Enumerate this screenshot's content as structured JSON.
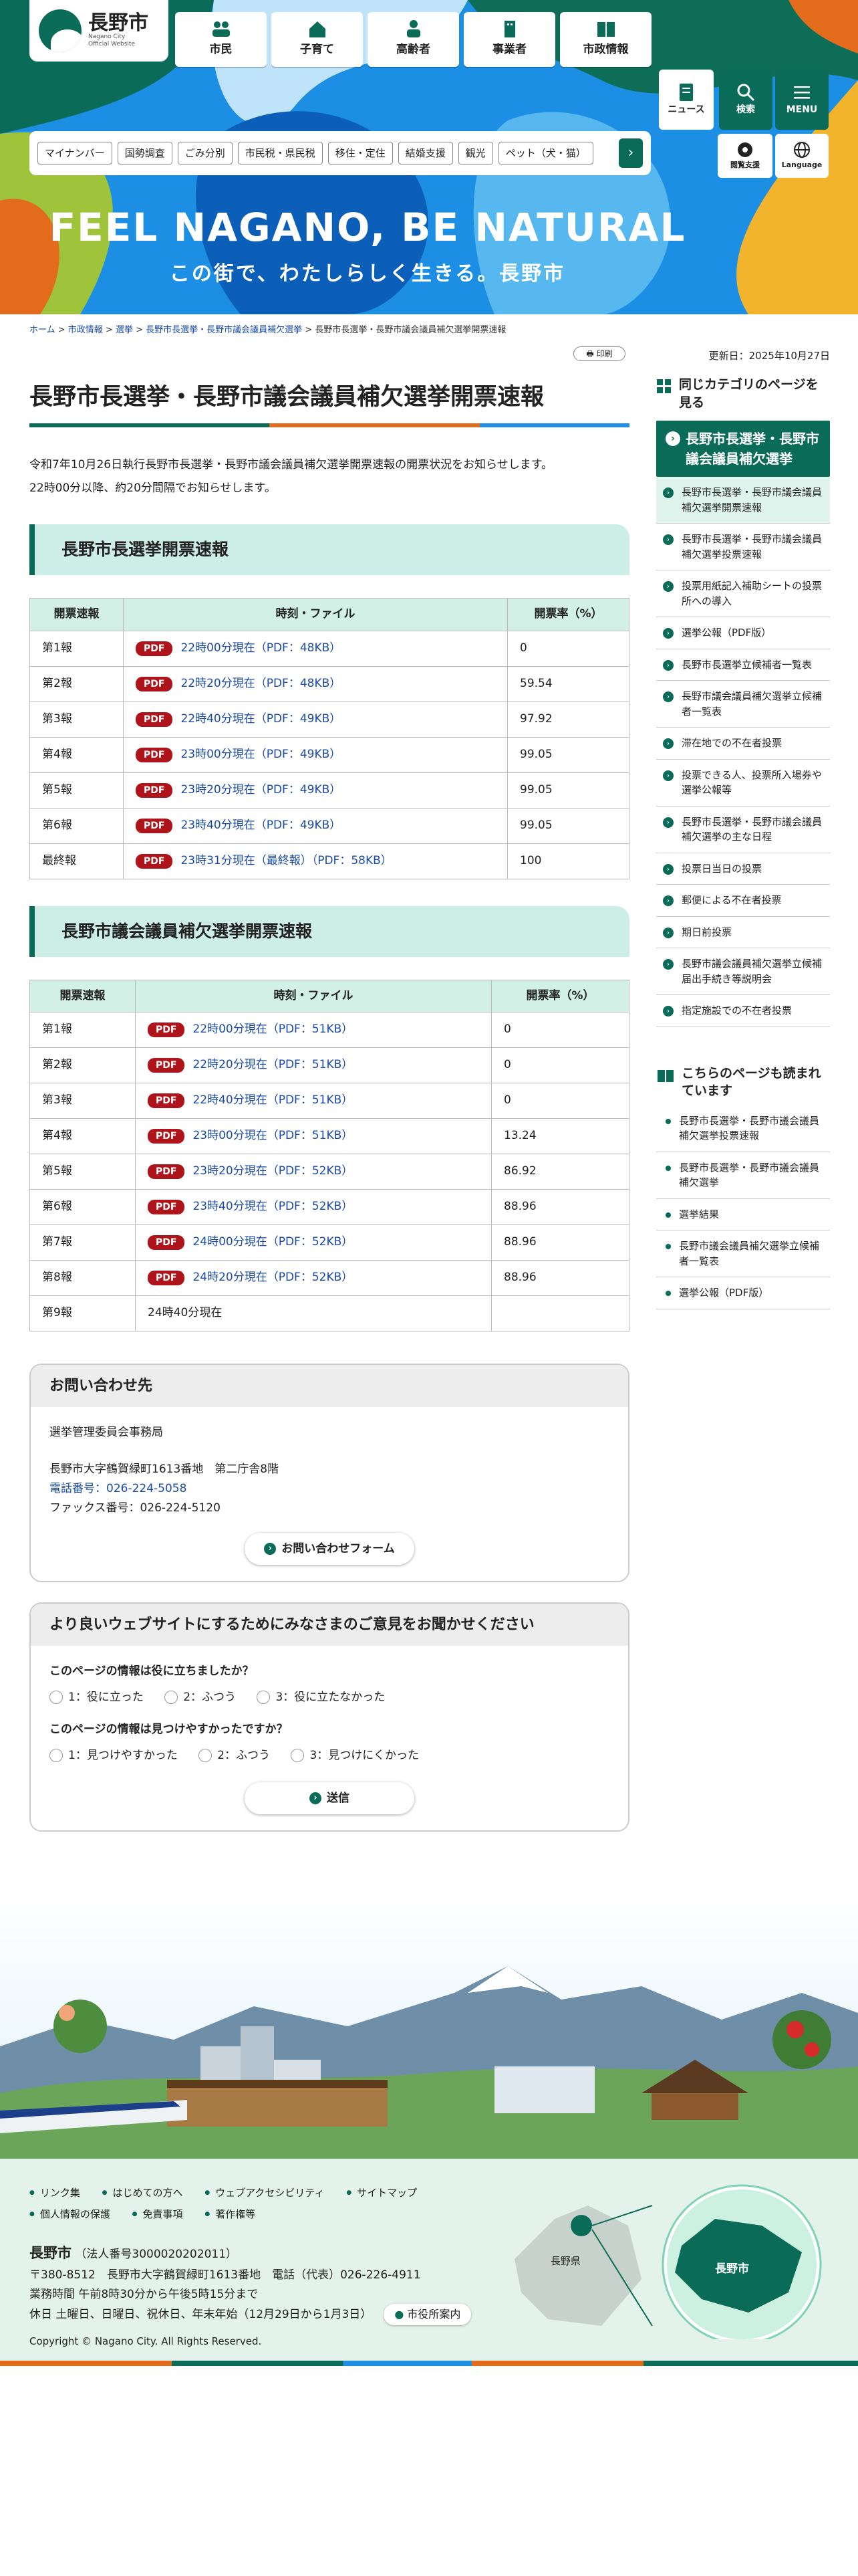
{
  "header": {
    "logo_name": "長野市",
    "logo_sub1": "Nagano City",
    "logo_sub2": "Official Website",
    "nav": [
      "市民",
      "子育て",
      "高齢者",
      "事業者",
      "市政情報"
    ],
    "news": "ニュース",
    "search": "検索",
    "menu": "MENU",
    "reader": "閲覧支援",
    "language": "Language",
    "categories": [
      "マイナンバー",
      "国勢調査",
      "ごみ分別",
      "市民税・県民税",
      "移住・定住",
      "結婚支援",
      "観光",
      "ペット（犬・猫）"
    ],
    "slogan_en": "FEEL NAGANO, BE NATURAL",
    "slogan_jp": "この街で、わたしらしく生きる。長野市"
  },
  "breadcrumb": {
    "home": "ホーム",
    "b1": "市政情報",
    "b2": "選挙",
    "b3": "長野市長選挙・長野市議会議員補欠選挙",
    "current": "長野市長選挙・長野市議会議員補欠選挙開票速報"
  },
  "print": "印刷",
  "updated": "更新日：2025年10月27日",
  "page": {
    "title": "長野市長選挙・長野市議会議員補欠選挙開票速報",
    "lead1": "令和7年10月26日執行長野市長選挙・長野市議会議員補欠選挙開票速報の開票状況をお知らせします。",
    "lead2": "22時00分以降、約20分間隔でお知らせします。",
    "pdf_badge": "PDF",
    "section1": "長野市長選挙開票速報",
    "section2": "長野市議会議員補欠選挙開票速報",
    "col1": "開票速報",
    "col2": "時刻・ファイル",
    "col3": "開票率（%）",
    "table1": [
      [
        "第1報",
        "22時00分現在（PDF：48KB）",
        "0"
      ],
      [
        "第2報",
        "22時20分現在（PDF：48KB）",
        "59.54"
      ],
      [
        "第3報",
        "22時40分現在（PDF：49KB）",
        "97.92"
      ],
      [
        "第4報",
        "23時00分現在（PDF：49KB）",
        "99.05"
      ],
      [
        "第5報",
        "23時20分現在（PDF：49KB）",
        "99.05"
      ],
      [
        "第6報",
        "23時40分現在（PDF：49KB）",
        "99.05"
      ],
      [
        "最終報",
        "23時31分現在（最終報）（PDF：58KB）",
        "100"
      ]
    ],
    "table2": [
      [
        "第1報",
        "22時00分現在（PDF：51KB）",
        "0"
      ],
      [
        "第2報",
        "22時20分現在（PDF：51KB）",
        "0"
      ],
      [
        "第3報",
        "22時40分現在（PDF：51KB）",
        "0"
      ],
      [
        "第4報",
        "23時00分現在（PDF：51KB）",
        "13.24"
      ],
      [
        "第5報",
        "23時20分現在（PDF：52KB）",
        "86.92"
      ],
      [
        "第6報",
        "23時40分現在（PDF：52KB）",
        "88.96"
      ],
      [
        "第7報",
        "24時00分現在（PDF：52KB）",
        "88.96"
      ],
      [
        "第8報",
        "24時20分現在（PDF：52KB）",
        "88.96"
      ],
      [
        "第9報",
        "24時40分現在",
        ""
      ]
    ]
  },
  "contact": {
    "title": "お問い合わせ先",
    "dept": "選挙管理委員会事務局",
    "address": "長野市大字鶴賀緑町1613番地　第二庁舎8階",
    "phone": "電話番号：026-224-5058",
    "fax": "ファックス番号：026-224-5120",
    "form_btn": "お問い合わせフォーム"
  },
  "survey": {
    "title": "より良いウェブサイトにするためにみなさまのご意見をお聞かせください",
    "q1": "このページの情報は役に立ちましたか？",
    "q1_opts": [
      "1：役に立った",
      "2：ふつう",
      "3：役に立たなかった"
    ],
    "q2": "このページの情報は見つけやすかったですか？",
    "q2_opts": [
      "1：見つけやすかった",
      "2：ふつう",
      "3：見つけにくかった"
    ],
    "submit": "送信"
  },
  "sidebar": {
    "cat_heading": "同じカテゴリのページを見る",
    "selected": "長野市長選挙・長野市議会議員補欠選挙",
    "items": [
      "長野市長選挙・長野市議会議員補欠選挙開票速報",
      "長野市長選挙・長野市議会議員補欠選挙投票速報",
      "投票用紙記入補助シートの投票所への導入",
      "選挙公報（PDF版）",
      "長野市長選挙立候補者一覧表",
      "長野市議会議員補欠選挙立候補者一覧表",
      "滞在地での不在者投票",
      "投票できる人、投票所入場券や選挙公報等",
      "長野市長選挙・長野市議会議員補欠選挙の主な日程",
      "投票日当日の投票",
      "郵便による不在者投票",
      "期日前投票",
      "長野市議会議員補欠選挙立候補届出手続き等説明会",
      "指定施設での不在者投票"
    ],
    "also_heading": "こちらのページも読まれています",
    "also": [
      "長野市長選挙・長野市議会議員補欠選挙投票速報",
      "長野市長選挙・長野市議会議員補欠選挙",
      "選挙結果",
      "長野市議会議員補欠選挙立候補者一覧表",
      "選挙公報（PDF版）"
    ]
  },
  "footer": {
    "links": [
      "リンク集",
      "はじめての方へ",
      "ウェブアクセシビリティ",
      "サイトマップ",
      "個人情報の保護",
      "免責事項",
      "著作権等"
    ],
    "org": "長野市",
    "corp_no": "（法人番号3000020202011）",
    "address": "〒380-8512　長野市大字鶴賀緑町1613番地　電話（代表）026-226-4911",
    "hours": "業務時間 午前8時30分から午後5時15分まで",
    "holidays": "休日 土曜日、日曜日、祝休日、年末年始（12月29日から1月3日）",
    "office_btn": "市役所案内",
    "map_pref": "長野県",
    "map_city": "長野市",
    "copyright": "Copyright © Nagano City. All Rights Reserved."
  }
}
